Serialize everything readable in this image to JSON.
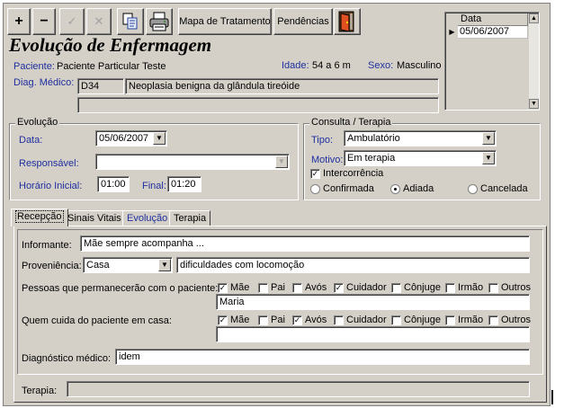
{
  "toolbar": {
    "add": "+",
    "remove": "−",
    "confirm": "✓",
    "cancel": "✕",
    "mapa_label": "Mapa de Tratamento",
    "pendencias_label": "Pendências"
  },
  "title": "Evolução de Enfermagem",
  "patient": {
    "paciente_label": "Paciente:",
    "paciente_value": "Paciente Particular Teste",
    "idade_label": "Idade:",
    "idade_value": "54 a 6 m",
    "sexo_label": "Sexo:",
    "sexo_value": "Masculino",
    "diag_label": "Diag. Médico:",
    "diag_code": "D34",
    "diag_desc": "Neoplasia benigna da glândula tireóide"
  },
  "date_list": {
    "header": "Data",
    "items": [
      "05/06/2007"
    ]
  },
  "evolucao": {
    "title": "Evolução",
    "data_label": "Data:",
    "data_value": "05/06/2007",
    "responsavel_label": "Responsável:",
    "responsavel_value": "",
    "horario_inicial_label": "Horário Inicial:",
    "horario_inicial_value": "01:00",
    "final_label": "Final:",
    "final_value": "01:20"
  },
  "consulta": {
    "title": "Consulta / Terapia",
    "tipo_label": "Tipo:",
    "tipo_value": "Ambulatório",
    "motivo_label": "Motivo:",
    "motivo_value": "Em terapia",
    "intercorrencia_label": "Intercorrência",
    "intercorrencia_checked": true,
    "radio_confirmada": "Confirmada",
    "radio_adiada": "Adiada",
    "radio_cancelada": "Cancelada",
    "selected": "Adiada"
  },
  "tabs": [
    "Recepção",
    "Sinais Vitais",
    "Evolução",
    "Terapia"
  ],
  "recepcao": {
    "informante_label": "Informante:",
    "informante_value": "Mãe sempre acompanha ...",
    "proveniencia_label": "Proveniência:",
    "proveniencia_value": "Casa",
    "proveniencia_obs": "dificuldades com locomoção",
    "pessoas_label": "Pessoas que permanecerão com o paciente:",
    "pessoas_options": [
      "Mãe",
      "Pai",
      "Avós",
      "Cuidador",
      "Cônjuge",
      "Irmão",
      "Outros"
    ],
    "pessoas_checked": [
      true,
      false,
      false,
      true,
      false,
      false,
      false
    ],
    "pessoas_outros": "Maria",
    "cuida_label": "Quem cuida do paciente em casa:",
    "cuida_options": [
      "Mãe",
      "Pai",
      "Avós",
      "Cuidador",
      "Cônjuge",
      "Irmão",
      "Outros"
    ],
    "cuida_checked": [
      true,
      false,
      true,
      false,
      false,
      false,
      false
    ],
    "cuida_outros": "",
    "diagnostico_label": "Diagnóstico médico:",
    "diagnostico_value": "idem",
    "terapia_label": "Terapia:",
    "terapia_value": ""
  },
  "icons": {
    "copy": "copy-icon",
    "print": "printer-icon",
    "exit": "exit-door-icon",
    "dropdown": "chevron-down-icon",
    "scroll_up": "arrow-up-icon",
    "scroll_down": "arrow-down-icon",
    "row_pointer": "row-pointer-icon"
  }
}
